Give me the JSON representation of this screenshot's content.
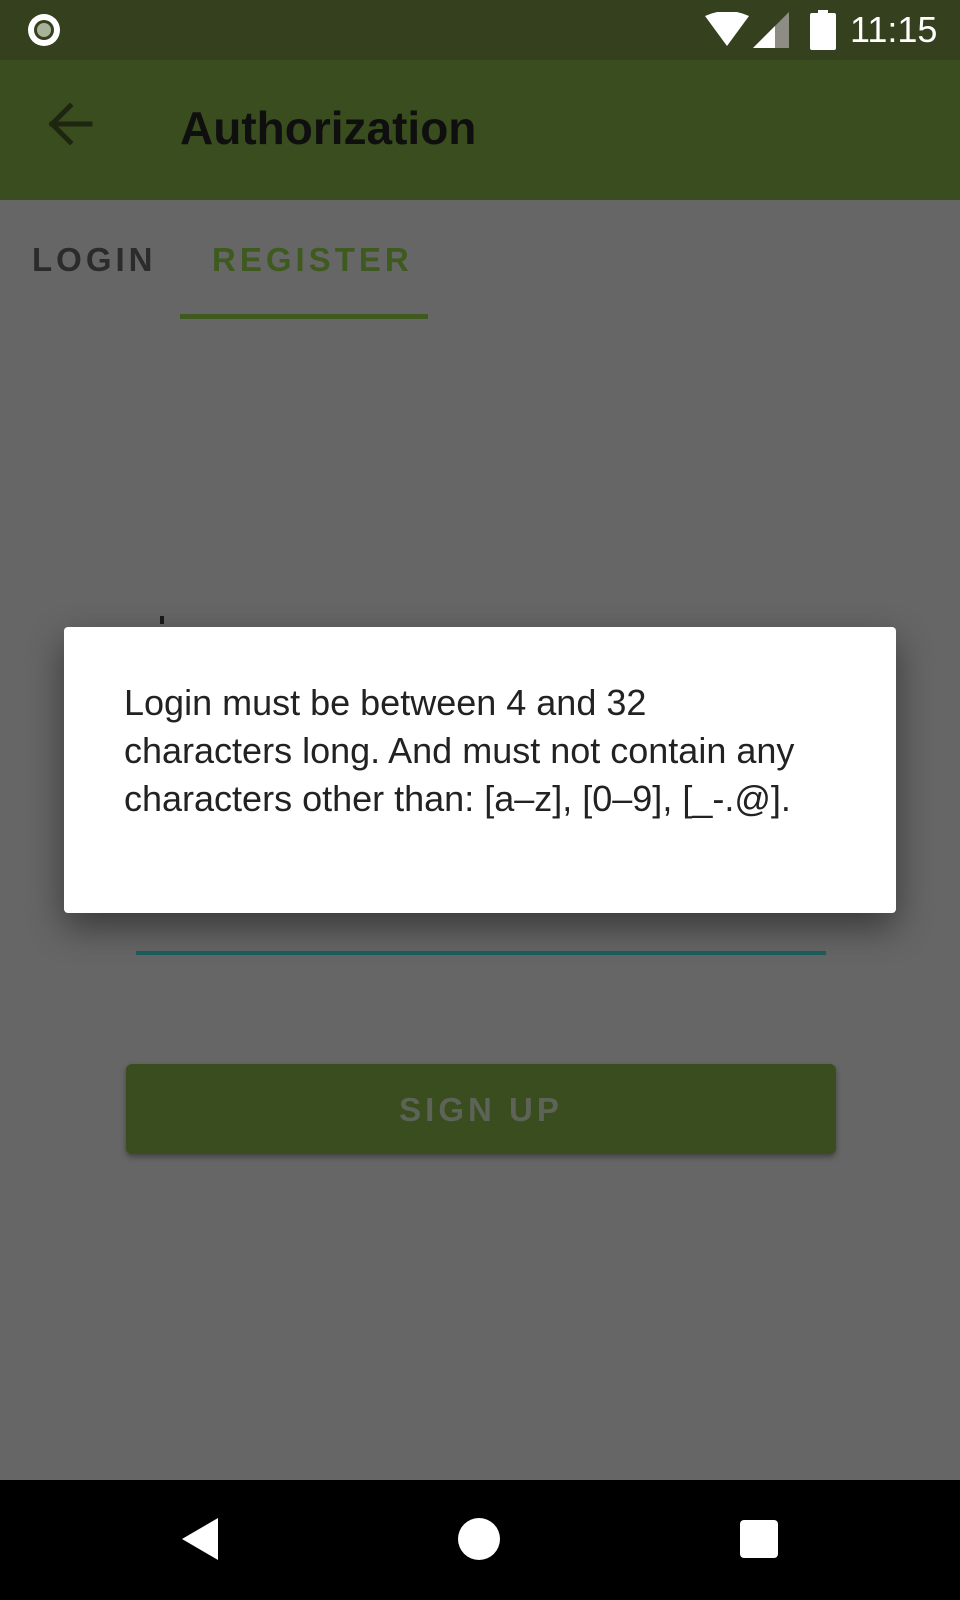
{
  "status_bar": {
    "time": "11:15",
    "icons": [
      "notification-dot-icon",
      "wifi-icon",
      "cell-signal-icon",
      "battery-icon"
    ]
  },
  "toolbar": {
    "title": "Authorization",
    "back_icon": "arrow-back-icon"
  },
  "tabs": [
    {
      "label": "LOGIN",
      "selected": false
    },
    {
      "label": "REGISTER",
      "selected": true
    }
  ],
  "form": {
    "password_masked": "•••",
    "signup_label": "SIGN UP"
  },
  "dialog": {
    "message": "Login must be between 4 and 32 characters long. And must not contain any characters other than: [a–z], [0–9], [_-.@]."
  },
  "nav_bar": {
    "icons": [
      "nav-back-icon",
      "nav-home-icon",
      "nav-recents-icon"
    ]
  },
  "colors": {
    "status_bar": "#35411E",
    "toolbar": "#3A4D1F",
    "scrim_background": "#666666",
    "tab_accent": "#3F5A1F",
    "field_underline": "#1C5E5E",
    "dialog_background": "#FFFFFF"
  }
}
